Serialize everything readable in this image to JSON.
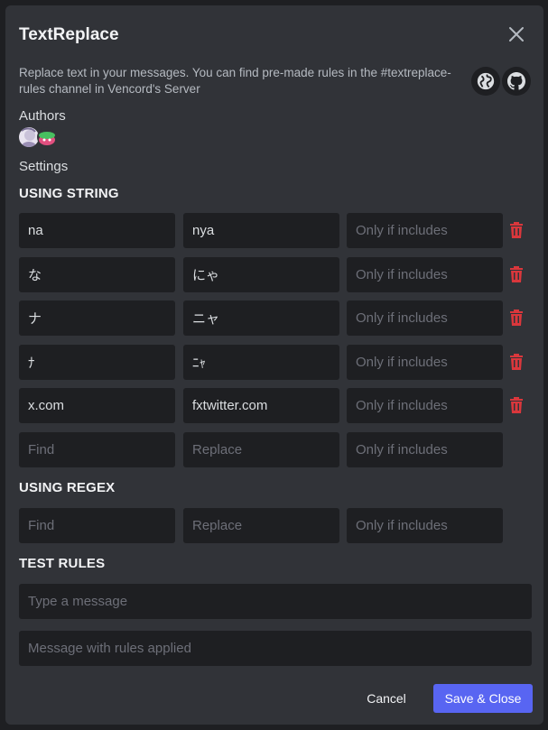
{
  "modal": {
    "title": "TextReplace",
    "description": "Replace text in your messages. You can find pre-made rules in the #textreplace-rules channel in Vencord's Server",
    "icons": [
      "globe-icon",
      "github-icon"
    ],
    "authors_label": "Authors",
    "settings_label": "Settings"
  },
  "string_rules": {
    "title": "USING STRING",
    "rows": [
      {
        "find": "na",
        "replace": "nya",
        "only_if": ""
      },
      {
        "find": "な",
        "replace": "にゃ",
        "only_if": ""
      },
      {
        "find": "ナ",
        "replace": "ニャ",
        "only_if": ""
      },
      {
        "find": "ﾅ",
        "replace": "ﾆｬ",
        "only_if": ""
      },
      {
        "find": "x.com",
        "replace": "fxtwitter.com",
        "only_if": ""
      },
      {
        "find": "",
        "replace": "",
        "only_if": ""
      }
    ]
  },
  "regex_rules": {
    "title": "USING REGEX",
    "rows": [
      {
        "find": "",
        "replace": "",
        "only_if": ""
      }
    ]
  },
  "placeholders": {
    "find": "Find",
    "replace": "Replace",
    "only_if": "Only if includes"
  },
  "test_rules": {
    "title": "TEST RULES",
    "input_placeholder": "Type a message",
    "output_placeholder": "Message with rules applied"
  },
  "footer": {
    "cancel_label": "Cancel",
    "save_label": "Save & Close"
  },
  "colors": {
    "accent": "#5865f2",
    "danger": "#da373c",
    "background": "#313338",
    "input_bg": "#1e1f22"
  }
}
